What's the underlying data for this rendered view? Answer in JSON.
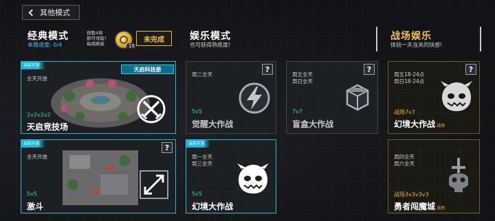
{
  "nav": {
    "back_label": "其他模式"
  },
  "sections": {
    "classic": {
      "title": "经典模式",
      "subtitle": "本周进度: 0/4"
    },
    "entertainment": {
      "title": "娱乐模式",
      "subtitle": "也可获得熟练度!"
    },
    "battle": {
      "title": "战场娱乐",
      "subtitle": "体验一夫当关的快感!"
    }
  },
  "classic_reward": {
    "line1": "获胜4局",
    "line2": "即可领取!",
    "line3": "每周刷新",
    "coin_count": "15",
    "status": "未完成"
  },
  "cards": {
    "arena": {
      "tag": "当前开放",
      "schedule": [
        "全天开放"
      ],
      "team": "2v2v2v2",
      "name": "天启竞技场",
      "badge": "天启科技册",
      "icon": "crossed-swords-icon"
    },
    "brawl": {
      "tag": "当前开放",
      "schedule": [
        "全天开放"
      ],
      "team": "5v5",
      "name": "激斗",
      "icon": "resize-arrows-icon"
    },
    "awaken": {
      "schedule": [
        "周二全天"
      ],
      "team": "5v5",
      "name": "觉醒大作战",
      "icon": "lightning-shield-icon"
    },
    "blindbox": {
      "schedule": [
        "周五全天",
        "周日全天"
      ],
      "team": "7v7",
      "name": "盲盒大作战",
      "icon": "lucky-box-icon"
    },
    "illusion_ent": {
      "tag": "当前开放",
      "schedule": [
        "周一全天",
        "周三全天"
      ],
      "team": "5v5",
      "name": "幻境大作战",
      "icon": "monster-head-icon"
    },
    "illusion_battle": {
      "schedule": [
        "周五18-24点",
        "周日18-24点"
      ],
      "team": "战场7v7",
      "name": "幻境大作战",
      "mode_tag": "战场",
      "icon": "monster-head-icon"
    },
    "demon_castle": {
      "schedule": [
        "周四全天",
        "周六全天"
      ],
      "team": "战场3v3v3v3",
      "name": "勇者闯魔城",
      "mode_tag": "战场",
      "icon": "skull-sword-icon"
    }
  },
  "help_label": "?",
  "colors": {
    "accent_cyan": "#1fb7d8",
    "accent_gold": "#e8b84a",
    "team_green": "#4ad99a"
  }
}
